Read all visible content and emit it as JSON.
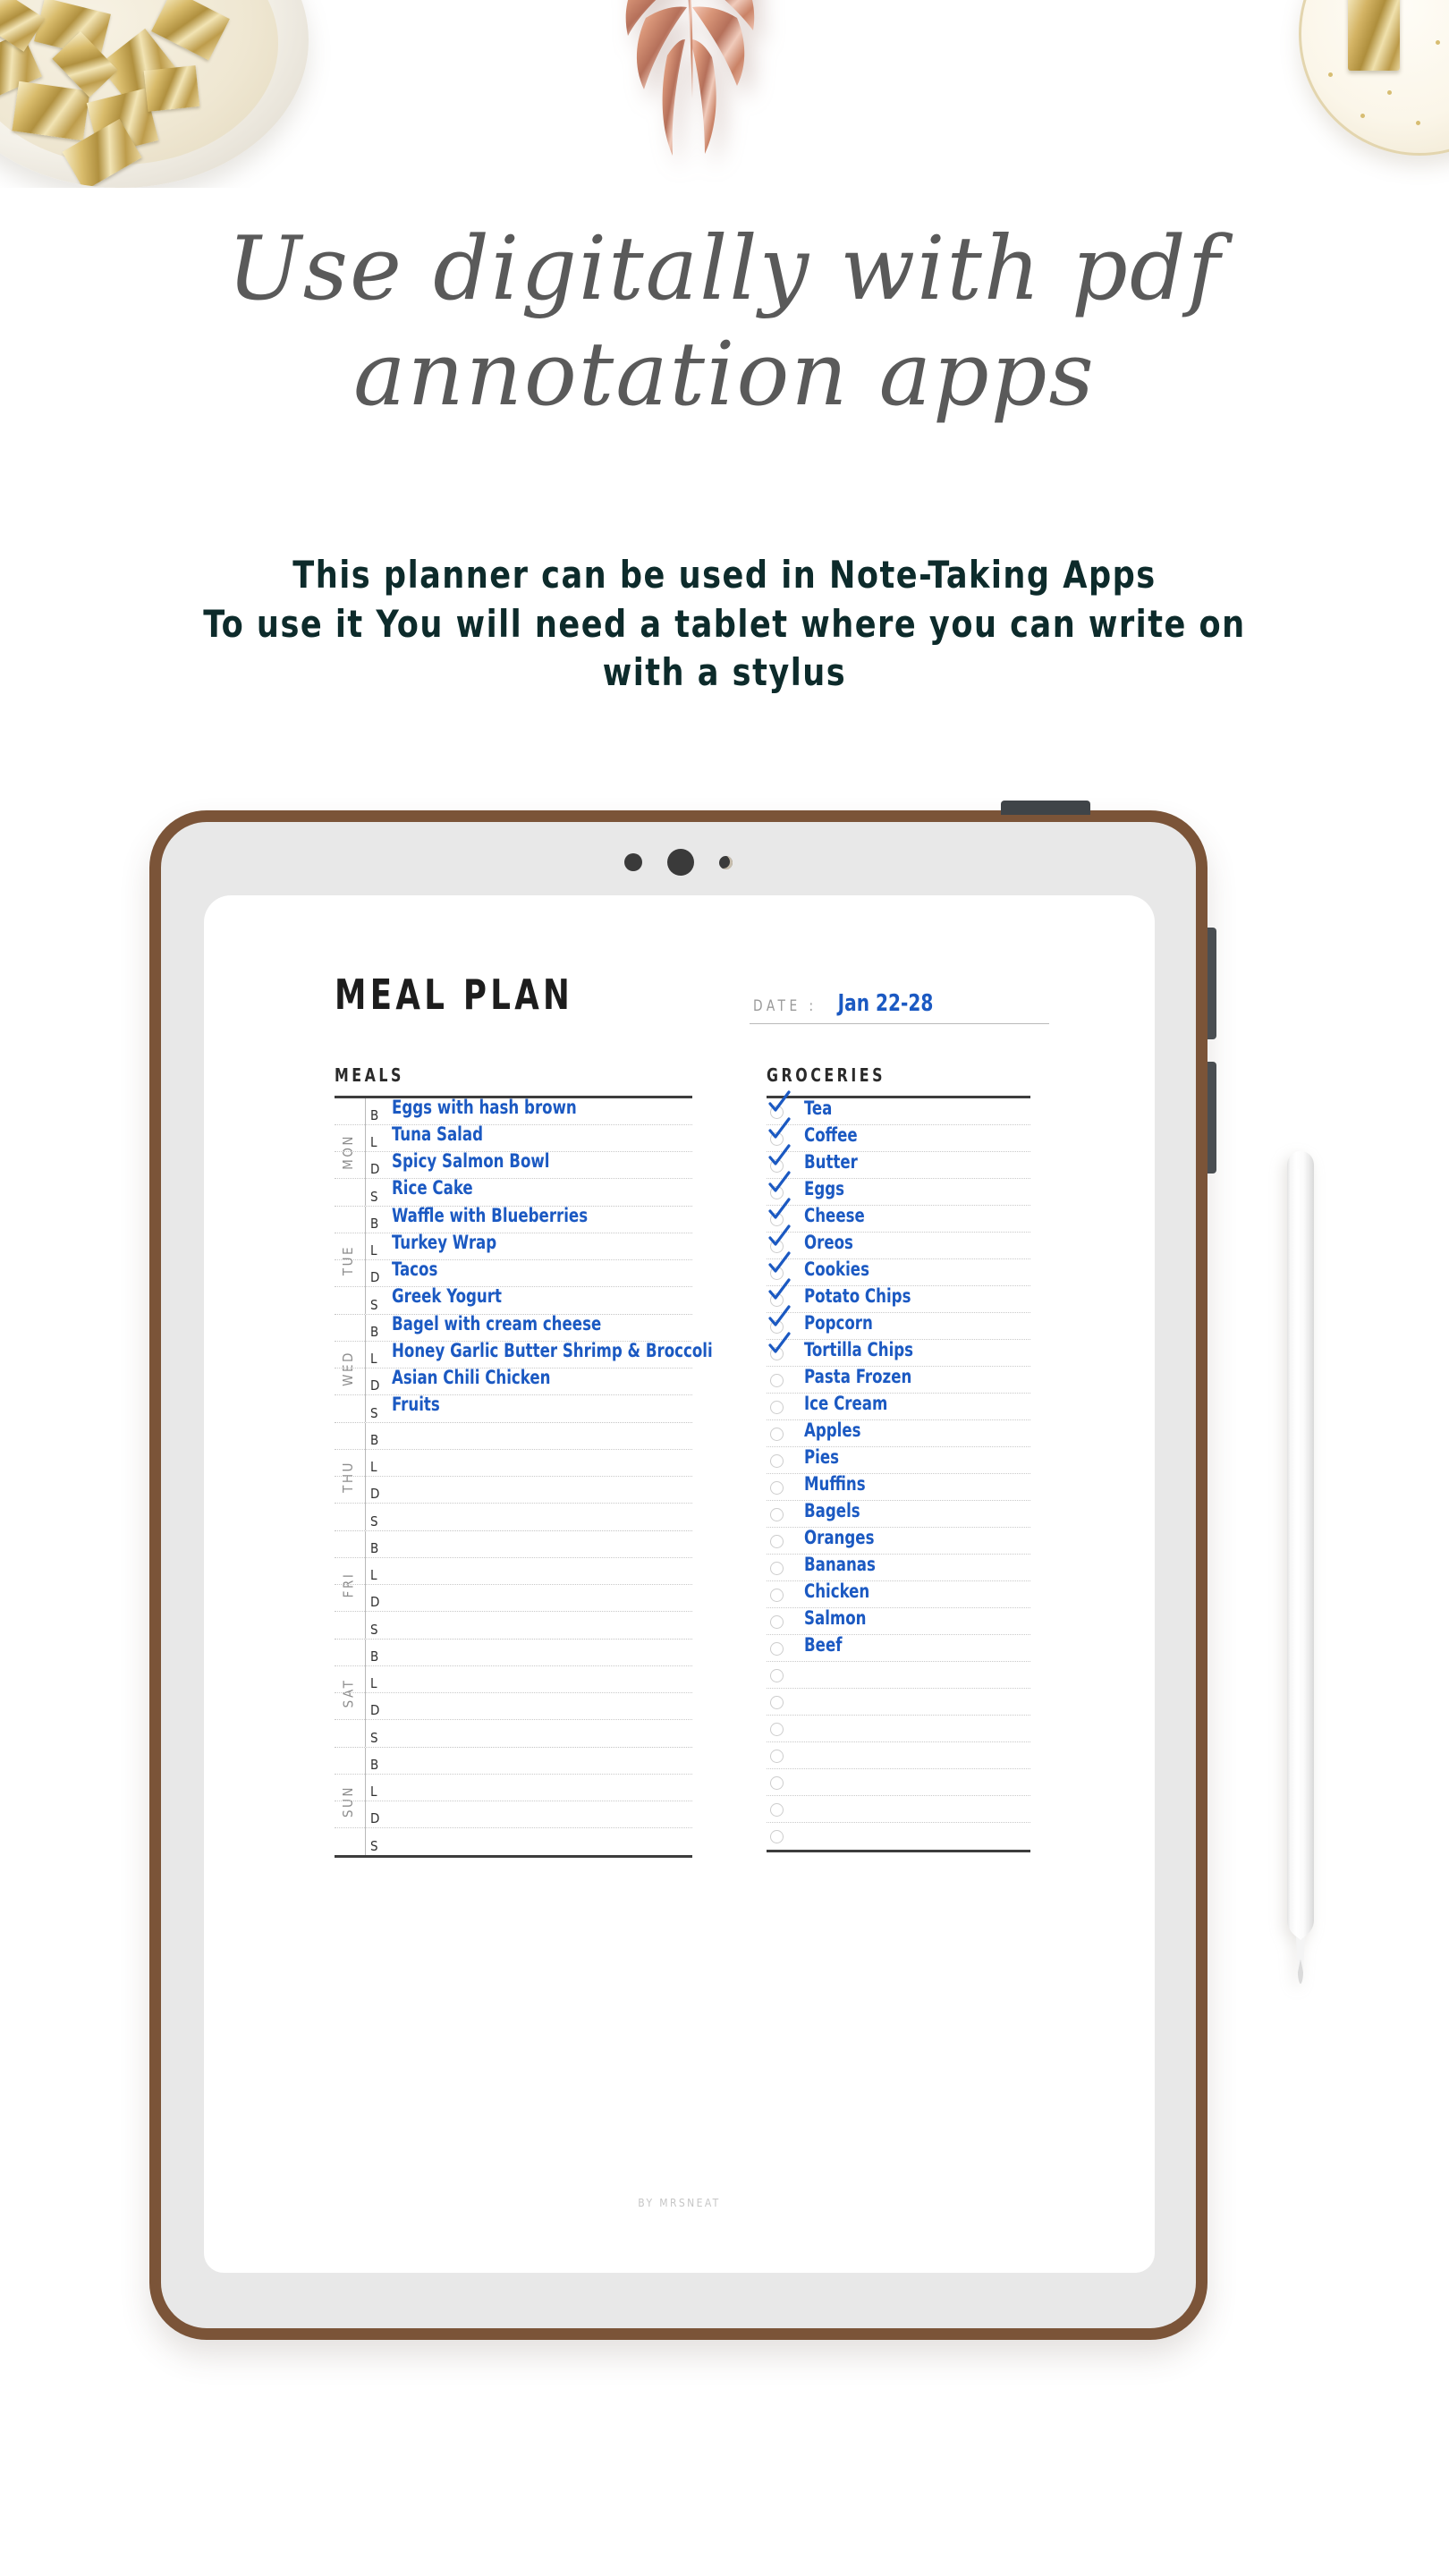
{
  "headline": {
    "line1": "Use digitally with pdf",
    "line2": "annotation apps"
  },
  "subtitle": {
    "line1": "This planner can be used in Note-Taking Apps",
    "line2": "To use it You will need a tablet where you can write on",
    "line3": "with a stylus"
  },
  "planner": {
    "title": "MEAL PLAN",
    "date_label": "DATE :",
    "date_value": "Jan 22-28",
    "meals_header": "MEALS",
    "groceries_header": "GROCERIES",
    "footer": "BY MRSNEAT",
    "accent_blue": "#1b59c2",
    "frame_brown": "#7b5438",
    "meal_codes": [
      "B",
      "L",
      "D",
      "S"
    ],
    "days": [
      {
        "label": "MON",
        "meals": [
          "Eggs with hash brown",
          "Tuna Salad",
          "Spicy Salmon Bowl",
          "Rice Cake"
        ]
      },
      {
        "label": "TUE",
        "meals": [
          "Waffle with Blueberries",
          "Turkey Wrap",
          "Tacos",
          "Greek Yogurt"
        ]
      },
      {
        "label": "WED",
        "meals": [
          "Bagel with cream cheese",
          "Honey Garlic Butter Shrimp & Broccoli",
          "Asian Chili Chicken",
          "Fruits"
        ]
      },
      {
        "label": "THU",
        "meals": [
          "",
          "",
          "",
          ""
        ]
      },
      {
        "label": "FRI",
        "meals": [
          "",
          "",
          "",
          ""
        ]
      },
      {
        "label": "SAT",
        "meals": [
          "",
          "",
          "",
          ""
        ]
      },
      {
        "label": "SUN",
        "meals": [
          "",
          "",
          "",
          ""
        ]
      }
    ],
    "groceries": [
      {
        "label": "Tea",
        "checked": true
      },
      {
        "label": "Coffee",
        "checked": true
      },
      {
        "label": "Butter",
        "checked": true
      },
      {
        "label": "Eggs",
        "checked": true
      },
      {
        "label": "Cheese",
        "checked": true
      },
      {
        "label": "Oreos",
        "checked": true
      },
      {
        "label": "Cookies",
        "checked": true
      },
      {
        "label": "Potato Chips",
        "checked": true
      },
      {
        "label": "Popcorn",
        "checked": true
      },
      {
        "label": "Tortilla Chips",
        "checked": true
      },
      {
        "label": "Pasta Frozen",
        "checked": false
      },
      {
        "label": "Ice Cream",
        "checked": false
      },
      {
        "label": "Apples",
        "checked": false
      },
      {
        "label": "Pies",
        "checked": false
      },
      {
        "label": "Muffins",
        "checked": false
      },
      {
        "label": "Bagels",
        "checked": false
      },
      {
        "label": "Oranges",
        "checked": false
      },
      {
        "label": "Bananas",
        "checked": false
      },
      {
        "label": "Chicken",
        "checked": false
      },
      {
        "label": "Salmon",
        "checked": false
      },
      {
        "label": "Beef",
        "checked": false
      },
      {
        "label": "",
        "checked": false
      },
      {
        "label": "",
        "checked": false
      },
      {
        "label": "",
        "checked": false
      },
      {
        "label": "",
        "checked": false
      },
      {
        "label": "",
        "checked": false
      },
      {
        "label": "",
        "checked": false
      },
      {
        "label": "",
        "checked": false
      }
    ]
  }
}
